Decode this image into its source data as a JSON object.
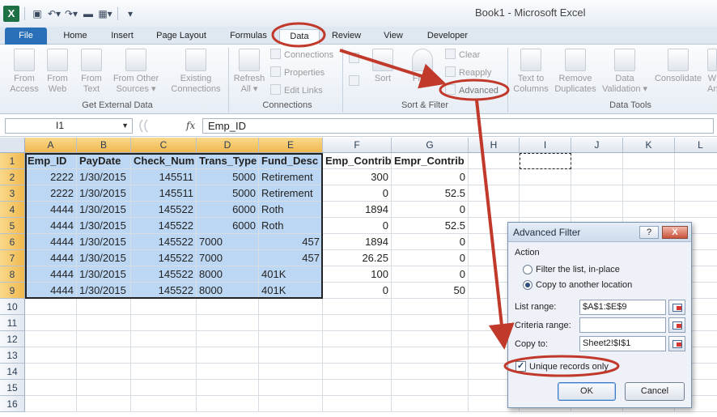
{
  "window": {
    "title": "Book1 - Microsoft Excel"
  },
  "qat": {
    "icons": [
      "excel-logo",
      "save-icon",
      "undo-icon",
      "redo-icon",
      "customize-icon"
    ]
  },
  "tabs": [
    {
      "label": "File"
    },
    {
      "label": "Home"
    },
    {
      "label": "Insert"
    },
    {
      "label": "Page Layout"
    },
    {
      "label": "Formulas"
    },
    {
      "label": "Data",
      "active": true
    },
    {
      "label": "Review"
    },
    {
      "label": "View"
    },
    {
      "label": "Developer"
    }
  ],
  "ribbon": {
    "get_external_data": {
      "label": "Get External Data",
      "from_access": [
        "From",
        "Access"
      ],
      "from_web": [
        "From",
        "Web"
      ],
      "from_text": [
        "From",
        "Text"
      ],
      "from_other": [
        "From Other",
        "Sources ▾"
      ],
      "existing": [
        "Existing",
        "Connections"
      ]
    },
    "connections": {
      "label": "Connections",
      "refresh": [
        "Refresh",
        "All ▾"
      ],
      "connections": "Connections",
      "properties": "Properties",
      "edit_links": "Edit Links"
    },
    "sort_filter": {
      "label": "Sort & Filter",
      "sort": "Sort",
      "filter": "Filter",
      "clear": "Clear",
      "reapply": "Reapply",
      "advanced": "Advanced"
    },
    "data_tools": {
      "label": "Data Tools",
      "text_to_columns": [
        "Text to",
        "Columns"
      ],
      "remove_duplicates": [
        "Remove",
        "Duplicates"
      ],
      "data_validation": [
        "Data",
        "Validation ▾"
      ],
      "consolidate": "Consolidate",
      "what_if": [
        "W",
        "An"
      ]
    }
  },
  "formula_bar": {
    "name_box": "I1",
    "fx": "fx",
    "value": "Emp_ID"
  },
  "columns": [
    "A",
    "B",
    "C",
    "D",
    "E",
    "F",
    "G",
    "H",
    "I",
    "J",
    "K",
    "L"
  ],
  "rows": [
    "1",
    "2",
    "3",
    "4",
    "5",
    "6",
    "7",
    "8",
    "9",
    "10",
    "11",
    "12",
    "13",
    "14",
    "15",
    "16"
  ],
  "table": {
    "headers": [
      "Emp_ID",
      "PayDate",
      "Check_Num",
      "Trans_Type",
      "Fund_Desc",
      "Emp_Contrib",
      "Empr_Contrib"
    ],
    "rows": [
      [
        "2222",
        "1/30/2015",
        "145511",
        "5000",
        "Retirement",
        "300",
        "0"
      ],
      [
        "2222",
        "1/30/2015",
        "145511",
        "5000",
        "Retirement",
        "0",
        "52.5"
      ],
      [
        "4444",
        "1/30/2015",
        "145522",
        "6000",
        "Roth",
        "1894",
        "0"
      ],
      [
        "4444",
        "1/30/2015",
        "145522",
        "6000",
        "Roth",
        "0",
        "52.5"
      ],
      [
        "4444",
        "1/30/2015",
        "145522",
        "7000",
        "457",
        "1894",
        "0"
      ],
      [
        "4444",
        "1/30/2015",
        "145522",
        "7000",
        "457",
        "26.25",
        "0"
      ],
      [
        "4444",
        "1/30/2015",
        "145522",
        "8000",
        "401K",
        "100",
        "0"
      ],
      [
        "4444",
        "1/30/2015",
        "145522",
        "8000",
        "401K",
        "0",
        "50"
      ]
    ]
  },
  "dialog": {
    "title": "Advanced Filter",
    "help": "?",
    "close": "X",
    "action_label": "Action",
    "option_filter": "Filter the list, in-place",
    "option_copy": "Copy to another location",
    "list_range_label": "List range:",
    "list_range_value": "$A$1:$E$9",
    "criteria_range_label": "Criteria range:",
    "criteria_range_value": "",
    "copy_to_label": "Copy to:",
    "copy_to_value": "Sheet2!$I$1",
    "unique_label": "Unique records only",
    "unique_checked": true,
    "ok": "OK",
    "cancel": "Cancel"
  },
  "colors": {
    "annotation": "#c0392b",
    "selection": "#bcd7f3",
    "file_tab": "#2a70b8"
  }
}
